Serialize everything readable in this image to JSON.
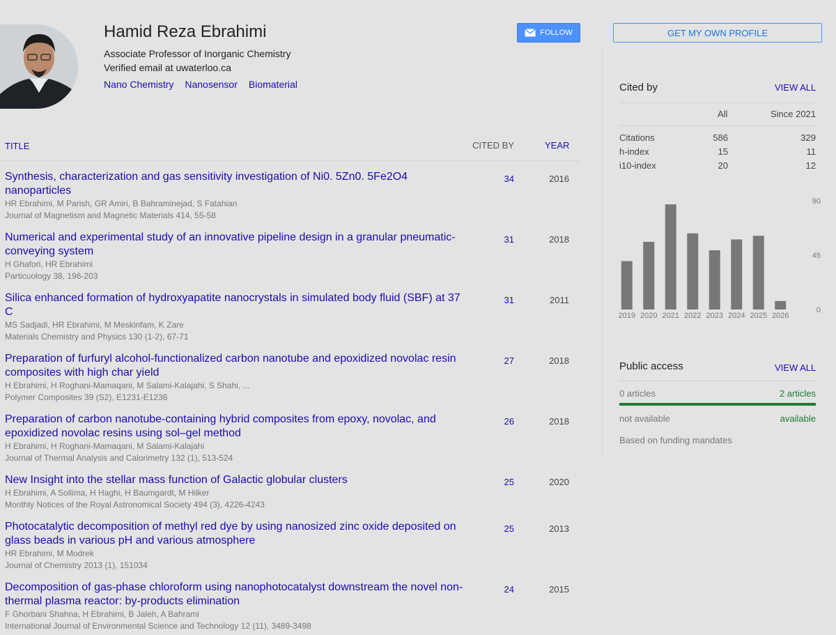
{
  "profile": {
    "name": "Hamid Reza Ebrahimi",
    "affiliation": "Associate Professor of Inorganic Chemistry",
    "email": "Verified email at uwaterloo.ca",
    "interests": [
      "Nano Chemistry",
      "Nanosensor",
      "Biomaterial"
    ]
  },
  "buttons": {
    "follow": "FOLLOW",
    "get_own_profile": "GET MY OWN PROFILE"
  },
  "table": {
    "headers": {
      "title": "TITLE",
      "cited_by": "CITED BY",
      "year": "YEAR"
    },
    "articles": [
      {
        "title": "Synthesis, characterization and gas sensitivity investigation of Ni0. 5Zn0. 5Fe2O4 nanoparticles",
        "authors": "HR Ebrahimi, M Parish, GR Amiri, B Bahraminejad, S Fatahian",
        "venue": "Journal of Magnetism and Magnetic Materials 414, 55-58",
        "cited_by": "34",
        "year": "2016"
      },
      {
        "title": "Numerical and experimental study of an innovative pipeline design in a granular pneumatic-conveying system",
        "authors": "H Ghafori, HR Ebrahimi",
        "venue": "Particuology 38, 196-203",
        "cited_by": "31",
        "year": "2018"
      },
      {
        "title": "Silica enhanced formation of hydroxyapatite nanocrystals in simulated body fluid (SBF) at 37 C",
        "authors": "MS Sadjadi, HR Ebrahimi, M Meskinfam, K Zare",
        "venue": "Materials Chemistry and Physics 130 (1-2), 67-71",
        "cited_by": "31",
        "year": "2011"
      },
      {
        "title": "Preparation of furfuryl alcohol-functionalized carbon nanotube and epoxidized novolac resin composites with high char yield",
        "authors": "H Ebrahimi, H Roghani-Mamaqani, M Salami-Kalajahi, S Shahi, ...",
        "venue": "Polymer Composites 39 (S2), E1231-E1236",
        "cited_by": "27",
        "year": "2018"
      },
      {
        "title": "Preparation of carbon nanotube-containing hybrid composites from epoxy, novolac, and epoxidized novolac resins using sol–gel method",
        "authors": "H Ebrahimi, H Roghani-Mamaqani, M Salami-Kalajahi",
        "venue": "Journal of Thermal Analysis and Calorimetry 132 (1), 513-524",
        "cited_by": "26",
        "year": "2018"
      },
      {
        "title": "New Insight into the stellar mass function of Galactic globular clusters",
        "authors": "H Ebrahimi, A Sollima, H Haghi, H Baumgardt, M Hilker",
        "venue": "Monthly Notices of the Royal Astronomical Society 494 (3), 4226-4243",
        "cited_by": "25",
        "year": "2020"
      },
      {
        "title": "Photocatalytic decomposition of methyl red dye by using nanosized zinc oxide deposited on glass beads in various pH and various atmosphere",
        "authors": "HR Ebrahimi, M Modrek",
        "venue": "Journal of Chemistry 2013 (1), 151034",
        "cited_by": "25",
        "year": "2013"
      },
      {
        "title": "Decomposition of gas-phase chloroform using nanophotocatalyst downstream the novel non-thermal plasma reactor: by-products elimination",
        "authors": "F Ghorbani Shahna, H Ebrahimi, B Jaleh, A Bahrami",
        "venue": "International Journal of Environmental Science and Technology 12 (11), 3489-3498",
        "cited_by": "24",
        "year": "2015"
      }
    ]
  },
  "cited_by": {
    "title": "Cited by",
    "view_all": "VIEW ALL",
    "col_all": "All",
    "col_since": "Since 2021",
    "rows": [
      {
        "label": "Citations",
        "all": "586",
        "since": "329"
      },
      {
        "label": "h-index",
        "all": "15",
        "since": "11"
      },
      {
        "label": "i10-index",
        "all": "20",
        "since": "12"
      }
    ]
  },
  "chart_data": {
    "type": "bar",
    "categories": [
      "2019",
      "2020",
      "2021",
      "2022",
      "2023",
      "2024",
      "2025",
      "2026"
    ],
    "values": [
      40,
      56,
      87,
      63,
      49,
      58,
      61,
      7
    ],
    "ylim": [
      0,
      90
    ],
    "yticks": [
      "90",
      "45",
      "0"
    ],
    "bar_color": "#777777"
  },
  "public_access": {
    "title": "Public access",
    "view_all": "VIEW ALL",
    "left_count": "0 articles",
    "right_count": "2 articles",
    "left_status": "not available",
    "right_status": "available",
    "available_fraction": 1.0,
    "note": "Based on funding mandates",
    "accent": "#1e7b34"
  }
}
